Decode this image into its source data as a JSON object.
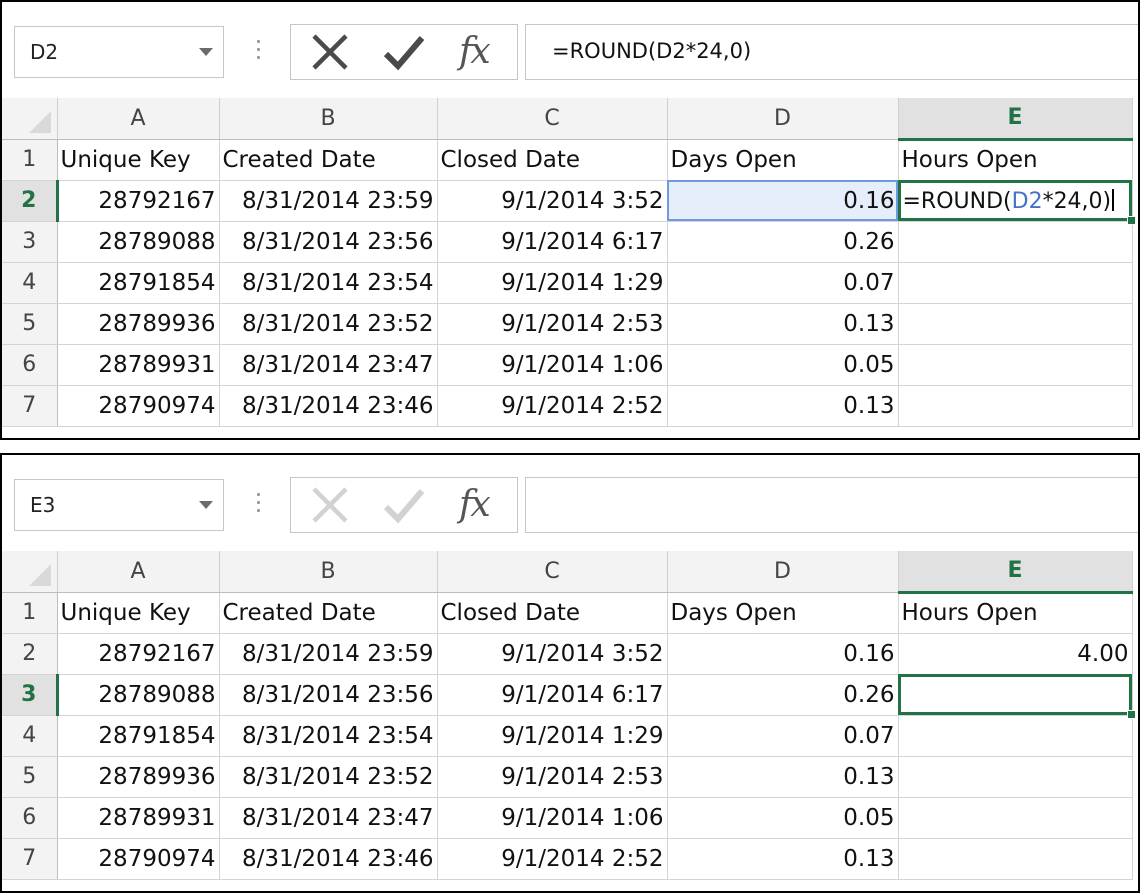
{
  "panels": [
    {
      "name_box": "D2",
      "formula": "=ROUND(D2*24,0)",
      "active_row": 2,
      "active_col": "E",
      "edit_formula_parts": [
        "=ROUND(",
        "D2",
        "*24,0)"
      ],
      "columns": [
        "A",
        "B",
        "C",
        "D",
        "E"
      ],
      "headers": [
        "Unique Key",
        "Created Date",
        "Closed Date",
        "Days Open",
        "Hours Open"
      ],
      "rows": [
        {
          "n": "1"
        },
        {
          "n": "2",
          "key": "28792167",
          "created": "8/31/2014 23:59",
          "closed": "9/1/2014 3:52",
          "days": "0.16",
          "hours": ""
        },
        {
          "n": "3",
          "key": "28789088",
          "created": "8/31/2014 23:56",
          "closed": "9/1/2014 6:17",
          "days": "0.26",
          "hours": ""
        },
        {
          "n": "4",
          "key": "28791854",
          "created": "8/31/2014 23:54",
          "closed": "9/1/2014 1:29",
          "days": "0.07",
          "hours": ""
        },
        {
          "n": "5",
          "key": "28789936",
          "created": "8/31/2014 23:52",
          "closed": "9/1/2014 2:53",
          "days": "0.13",
          "hours": ""
        },
        {
          "n": "6",
          "key": "28789931",
          "created": "8/31/2014 23:47",
          "closed": "9/1/2014 1:06",
          "days": "0.05",
          "hours": ""
        },
        {
          "n": "7",
          "key": "28790974",
          "created": "8/31/2014 23:46",
          "closed": "9/1/2014 2:52",
          "days": "0.13",
          "hours": ""
        }
      ]
    },
    {
      "name_box": "E3",
      "formula": "",
      "active_row": 3,
      "active_col": "E",
      "columns": [
        "A",
        "B",
        "C",
        "D",
        "E"
      ],
      "headers": [
        "Unique Key",
        "Created Date",
        "Closed Date",
        "Days Open",
        "Hours Open"
      ],
      "rows": [
        {
          "n": "1"
        },
        {
          "n": "2",
          "key": "28792167",
          "created": "8/31/2014 23:59",
          "closed": "9/1/2014 3:52",
          "days": "0.16",
          "hours": "4.00"
        },
        {
          "n": "3",
          "key": "28789088",
          "created": "8/31/2014 23:56",
          "closed": "9/1/2014 6:17",
          "days": "0.26",
          "hours": ""
        },
        {
          "n": "4",
          "key": "28791854",
          "created": "8/31/2014 23:54",
          "closed": "9/1/2014 1:29",
          "days": "0.07",
          "hours": ""
        },
        {
          "n": "5",
          "key": "28789936",
          "created": "8/31/2014 23:52",
          "closed": "9/1/2014 2:53",
          "days": "0.13",
          "hours": ""
        },
        {
          "n": "6",
          "key": "28789931",
          "created": "8/31/2014 23:47",
          "closed": "9/1/2014 1:06",
          "days": "0.05",
          "hours": ""
        },
        {
          "n": "7",
          "key": "28790974",
          "created": "8/31/2014 23:46",
          "closed": "9/1/2014 2:52",
          "days": "0.13",
          "hours": ""
        }
      ]
    }
  ],
  "icons": {
    "cancel": "close-icon",
    "enter": "checkmark-icon",
    "function": "fx-icon",
    "fx_label": "fx"
  },
  "colors": {
    "excel_green": "#217346",
    "reference_blue": "#4472c4"
  }
}
